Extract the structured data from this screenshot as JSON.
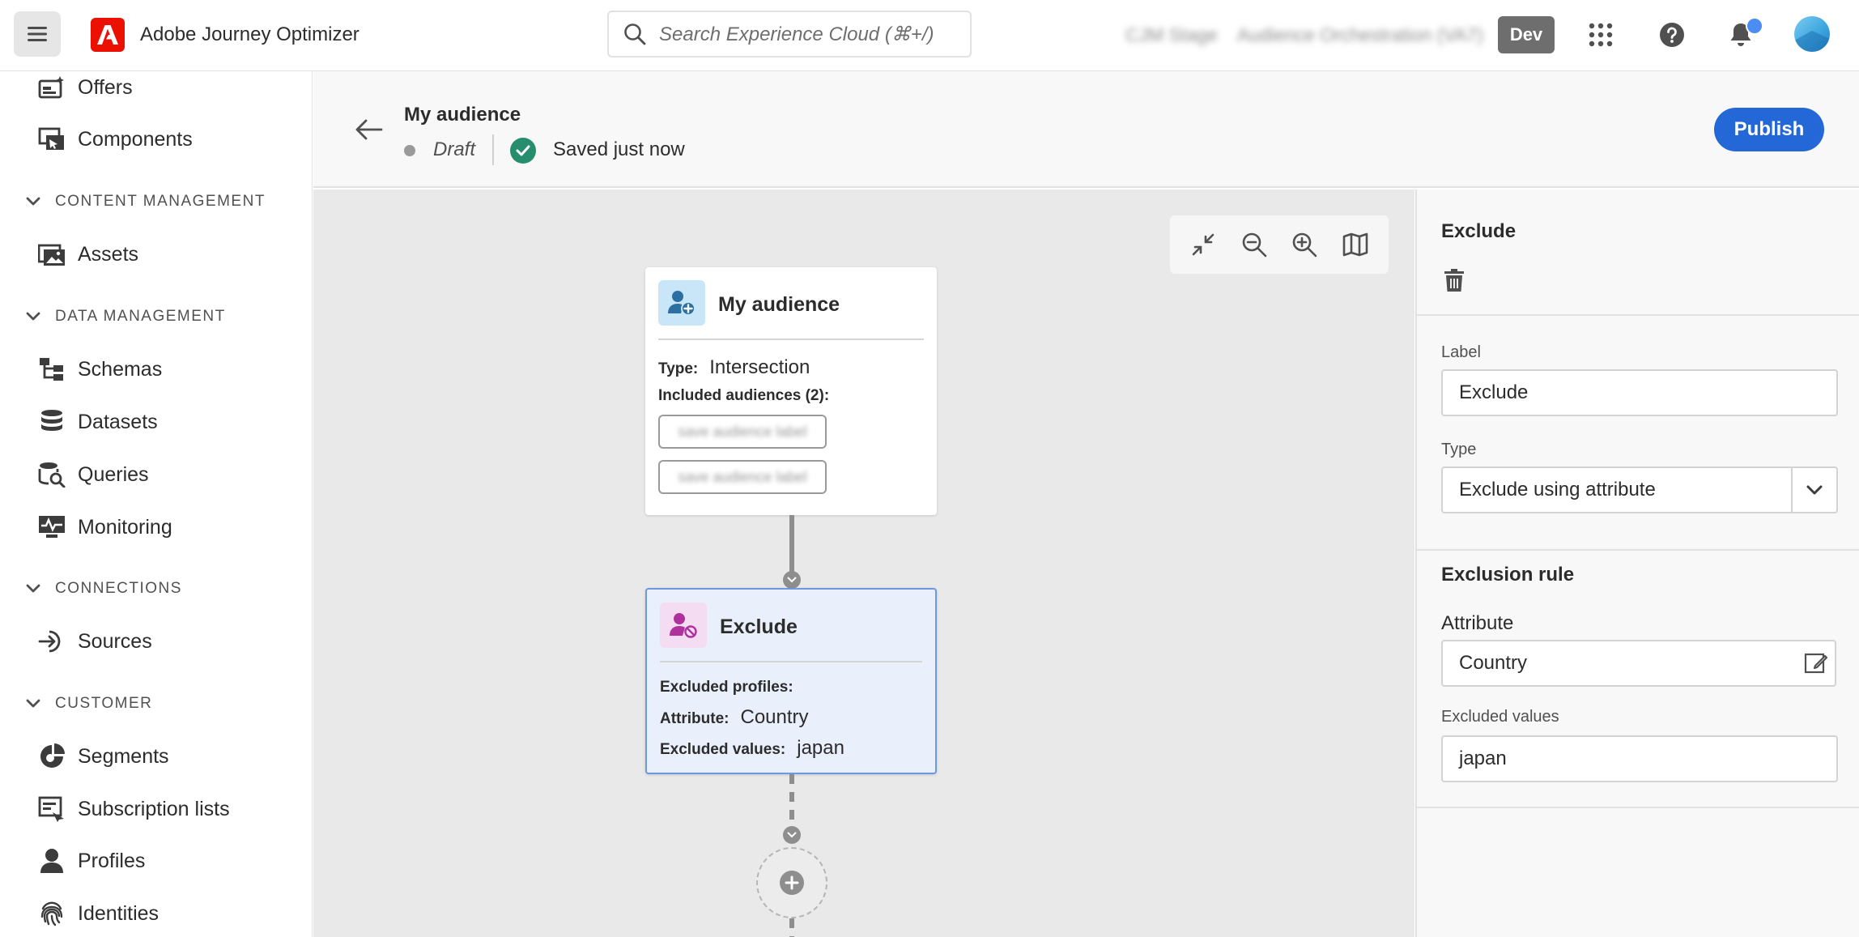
{
  "topbar": {
    "app_title": "Adobe Journey Optimizer",
    "search_placeholder": "Search Experience Cloud (⌘+/)",
    "sandbox_label": "CJM Stage",
    "org_label": "Audience Orchestration (VA7)",
    "env_badge": "Dev",
    "brand_color": "#eb1000"
  },
  "sidebar": {
    "items_top": [
      {
        "label": "Offers",
        "icon": "offers-icon"
      },
      {
        "label": "Components",
        "icon": "components-icon"
      }
    ],
    "sections": [
      {
        "title": "CONTENT MANAGEMENT",
        "items": [
          {
            "label": "Assets",
            "icon": "assets-icon"
          }
        ]
      },
      {
        "title": "DATA MANAGEMENT",
        "items": [
          {
            "label": "Schemas",
            "icon": "schemas-icon"
          },
          {
            "label": "Datasets",
            "icon": "datasets-icon"
          },
          {
            "label": "Queries",
            "icon": "queries-icon"
          },
          {
            "label": "Monitoring",
            "icon": "monitoring-icon"
          }
        ]
      },
      {
        "title": "CONNECTIONS",
        "items": [
          {
            "label": "Sources",
            "icon": "sources-icon"
          }
        ]
      },
      {
        "title": "CUSTOMER",
        "items": [
          {
            "label": "Segments",
            "icon": "segments-icon"
          },
          {
            "label": "Subscription lists",
            "icon": "subscription-lists-icon"
          },
          {
            "label": "Profiles",
            "icon": "profiles-icon"
          },
          {
            "label": "Identities",
            "icon": "identities-icon"
          }
        ]
      }
    ]
  },
  "header": {
    "title": "My audience",
    "status": "Draft",
    "saved": "Saved just now",
    "publish_label": "Publish",
    "accent_color": "#2468d8"
  },
  "canvas": {
    "audience_node": {
      "title": "My audience",
      "type_key": "Type:",
      "type_value": "Intersection",
      "included_label": "Included audiences (2):",
      "chips": [
        "save audience label",
        "save audience label"
      ]
    },
    "exclude_node": {
      "title": "Exclude",
      "excluded_profiles_key": "Excluded profiles:",
      "attribute_key": "Attribute:",
      "attribute_value": "Country",
      "excluded_values_key": "Excluded values:",
      "excluded_values_value": "japan"
    }
  },
  "panel": {
    "title": "Exclude",
    "label_label": "Label",
    "label_value": "Exclude",
    "type_label": "Type",
    "type_value": "Exclude using attribute",
    "rule_title": "Exclusion rule",
    "attribute_label": "Attribute",
    "attribute_value": "Country",
    "excluded_values_label": "Excluded values",
    "excluded_values_value": "japan"
  }
}
